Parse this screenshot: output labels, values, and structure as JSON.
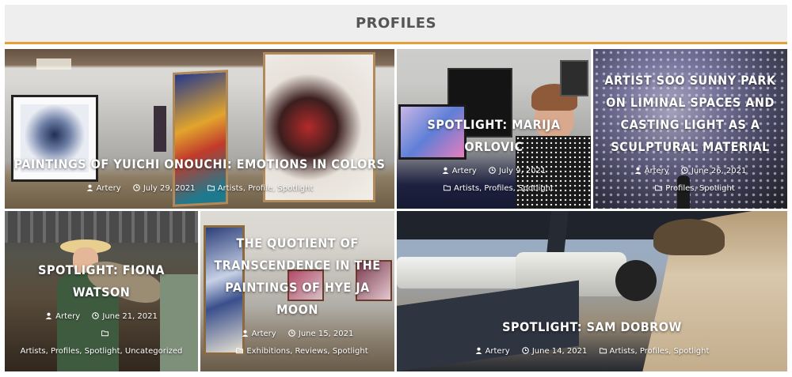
{
  "section_title": "PROFILES",
  "posts": [
    {
      "title": "PAINTINGS OF YUICHI ONOUCHI: EMOTIONS IN COLORS",
      "author": "Artery",
      "date": "July 29, 2021",
      "categories": "Artists, Profile, Spotlight"
    },
    {
      "title": "SPOTLIGHT: MARIJA ORLOVIC",
      "author": "Artery",
      "date": "July 9, 2021",
      "categories": "Artists, Profiles, Spotlight"
    },
    {
      "title": "ARTIST SOO SUNNY PARK ON LIMINAL SPACES AND CASTING LIGHT AS A SCULPTURAL MATERIAL",
      "author": "Artery",
      "date": "June 26, 2021",
      "categories": "Profiles, Spotlight"
    },
    {
      "title": "SPOTLIGHT: FIONA WATSON",
      "author": "Artery",
      "date": "June 21, 2021",
      "categories": "Artists, Profiles, Spotlight, Uncategorized"
    },
    {
      "title": "THE QUOTIENT OF TRANSCENDENCE IN THE PAINTINGS OF HYE JA MOON",
      "author": "Artery",
      "date": "June 15, 2021",
      "categories": "Exhibitions, Reviews, Spotlight"
    },
    {
      "title": "SPOTLIGHT: SAM DOBROW",
      "author": "Artery",
      "date": "June 14, 2021",
      "categories": "Artists, Profiles, Spotlight"
    }
  ],
  "icons": {
    "author": "user-icon",
    "date": "clock-icon",
    "category": "folder-icon"
  },
  "colors": {
    "accent": "#e4a13a",
    "header_bg": "#eeeeee",
    "header_text": "#555555",
    "overlay_text": "#ffffff"
  }
}
